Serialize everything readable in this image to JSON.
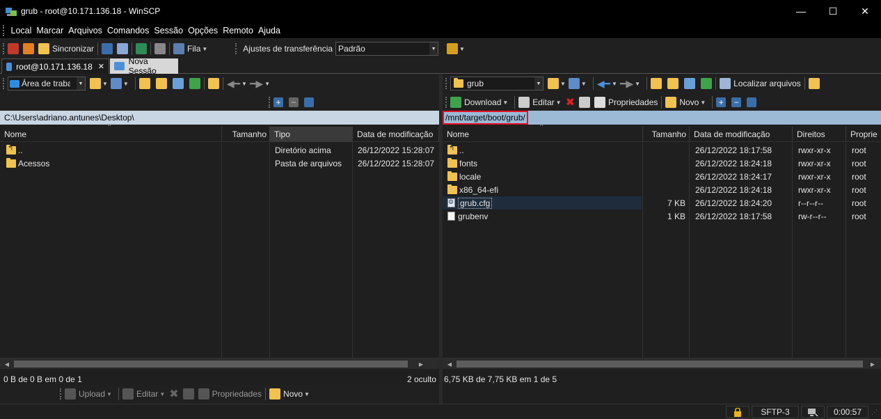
{
  "window": {
    "title": "grub - root@10.171.136.18 - WinSCP",
    "minimize": "—",
    "maximize": "☐",
    "close": "✕"
  },
  "menu": [
    "Local",
    "Marcar",
    "Arquivos",
    "Comandos",
    "Sessão",
    "Opções",
    "Remoto",
    "Ajuda"
  ],
  "toolbar": {
    "sync_label": "Sincronizar",
    "queue_label": "Fila",
    "transfer_label": "Ajustes de transferência",
    "transfer_value": "Padrão"
  },
  "tabs": [
    {
      "label": "root@10.171.136.18",
      "close": "✕"
    },
    {
      "label": "Nova Sessão"
    }
  ],
  "left": {
    "drive": "Área de traba",
    "path": "C:\\Users\\adriano.antunes\\Desktop\\",
    "columns": [
      "Nome",
      "Tamanho",
      "Tipo",
      "Data de modificação"
    ],
    "rows": [
      {
        "name": "..",
        "size": "",
        "type": "Diretório acima",
        "date": "26/12/2022  15:28:07"
      },
      {
        "name": "Acessos",
        "size": "",
        "type": "Pasta de arquivos",
        "date": "26/12/2022  15:28:07"
      }
    ],
    "status": "0 B de 0 B em 0 de 1",
    "hidden": "2 oculto",
    "actions": {
      "upload": "Upload",
      "edit": "Editar",
      "properties": "Propriedades",
      "new": "Novo"
    }
  },
  "right": {
    "dir": "grub",
    "find_label": "Localizar arquivos",
    "path": "/mnt/target/boot/grub/",
    "columns": [
      "Nome",
      "Tamanho",
      "Data de modificação",
      "Direitos",
      "Proprie"
    ],
    "rows": [
      {
        "name": "..",
        "size": "",
        "date": "26/12/2022 18:17:58",
        "rights": "rwxr-xr-x",
        "owner": "root"
      },
      {
        "name": "fonts",
        "size": "",
        "date": "26/12/2022 18:24:18",
        "rights": "rwxr-xr-x",
        "owner": "root"
      },
      {
        "name": "locale",
        "size": "",
        "date": "26/12/2022 18:24:17",
        "rights": "rwxr-xr-x",
        "owner": "root"
      },
      {
        "name": "x86_64-efi",
        "size": "",
        "date": "26/12/2022 18:24:18",
        "rights": "rwxr-xr-x",
        "owner": "root"
      },
      {
        "name": "grub.cfg",
        "size": "7 KB",
        "date": "26/12/2022 18:24:20",
        "rights": "r--r--r--",
        "owner": "root"
      },
      {
        "name": "grubenv",
        "size": "1 KB",
        "date": "26/12/2022 18:17:58",
        "rights": "rw-r--r--",
        "owner": "root"
      }
    ],
    "status": "6,75 KB de 7,75 KB em 1 de 5",
    "actions": {
      "download": "Download",
      "edit": "Editar",
      "properties": "Propriedades",
      "new": "Novo"
    }
  },
  "statusbar": {
    "protocol": "SFTP-3",
    "time": "0:00:57"
  },
  "colors": {
    "highlight": "#e81123",
    "selected_row": "#1e2c3c",
    "path_inactive": "#c8d5e2",
    "path_active": "#9cb9d6"
  }
}
